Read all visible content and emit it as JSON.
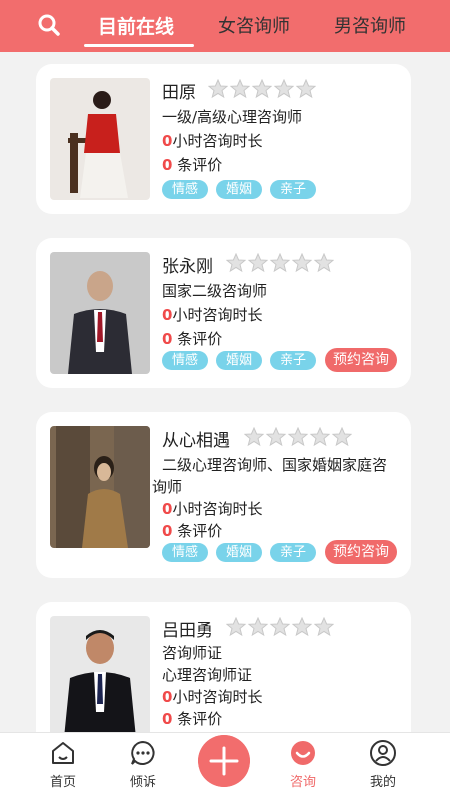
{
  "header": {
    "tabs": [
      "目前在线",
      "女咨询师",
      "男咨询师"
    ]
  },
  "counselors": [
    {
      "name": "田原",
      "titles": [
        "一级/高级心理咨询师"
      ],
      "hours_value": "0",
      "hours_label": "小时咨询时长",
      "reviews_value": "0",
      "reviews_label": "条评价",
      "tags": [
        "情感",
        "婚姻",
        "亲子"
      ],
      "book_label": "",
      "rating": 0
    },
    {
      "name": "张永刚",
      "titles": [
        "国家二级咨询师"
      ],
      "hours_value": "0",
      "hours_label": "小时咨询时长",
      "reviews_value": "0",
      "reviews_label": "条评价",
      "tags": [
        "情感",
        "婚姻",
        "亲子"
      ],
      "book_label": "预约咨询",
      "rating": 0
    },
    {
      "name": "从心相遇",
      "titles": [
        "二级心理咨询师、国家婚姻家庭咨",
        "询师"
      ],
      "hours_value": "0",
      "hours_label": "小时咨询时长",
      "reviews_value": "0",
      "reviews_label": "条评价",
      "tags": [
        "情感",
        "婚姻",
        "亲子"
      ],
      "book_label": "预约咨询",
      "rating": 0
    },
    {
      "name": "吕田勇",
      "titles": [
        "咨询师证",
        "心理咨询师证"
      ],
      "hours_value": "0",
      "hours_label": "小时咨询时长",
      "reviews_value": "0",
      "reviews_label": "条评价",
      "tags": [],
      "book_label": "",
      "rating": 0
    }
  ],
  "tabbar": {
    "items": [
      "首页",
      "倾诉",
      "咨询",
      "我的"
    ]
  },
  "colors": {
    "accent": "#f26d6d",
    "tag": "#79d3ea",
    "highlight": "#f04a4a"
  }
}
